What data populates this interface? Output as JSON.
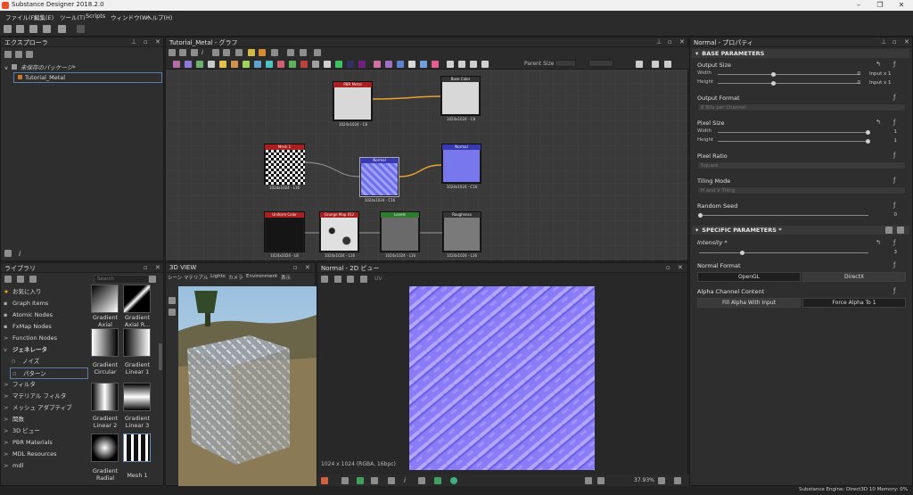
{
  "window": {
    "title": "Substance Designer 2018.2.0"
  },
  "menu": [
    "ファイル(F)",
    "編集(E)",
    "ツール(T)",
    "Scripts",
    "ウィンドウ(W)",
    "ヘルプ(H)"
  ],
  "explorer": {
    "title": "エクスプローラ",
    "package": "未保存のパッケージ*",
    "graph": "Tutorial_Metal"
  },
  "graph": {
    "title": "Tutorial_Metal - グラフ",
    "parent_size_label": "Parent Size",
    "nodes": [
      {
        "name": "PBR Metal Roughness",
        "label": "1024x1024 - C8"
      },
      {
        "name": "Base Color",
        "label": "1024x1024 - C8"
      },
      {
        "name": "Mesh 1",
        "label": "1024x1024 - L16"
      },
      {
        "name": "Normal",
        "label": "1024x1024 - C16"
      },
      {
        "name": "Normal",
        "label": "1024x1024 - C16"
      },
      {
        "name": "Uniform Color",
        "label": "1024x1024 - L8"
      },
      {
        "name": "Grunge Map 012",
        "label": "1024x1024 - L16"
      },
      {
        "name": "Levels",
        "label": "1024x1024 - L16"
      },
      {
        "name": "Roughness",
        "label": "1024x1024 - L16"
      }
    ]
  },
  "library": {
    "title": "ライブラリ",
    "search_placeholder": "Search",
    "items": [
      {
        "arrow": "",
        "label": "お気に入り"
      },
      {
        "arrow": "",
        "label": "Graph Items"
      },
      {
        "arrow": "",
        "label": "Atomic Nodes"
      },
      {
        "arrow": "",
        "label": "FxMap Nodes"
      },
      {
        "arrow": ">",
        "label": "Function Nodes"
      },
      {
        "arrow": "v",
        "label": "ジェネレータ"
      },
      {
        "arrow": "",
        "label": "ノイズ"
      },
      {
        "arrow": "",
        "label": "パターン"
      },
      {
        "arrow": ">",
        "label": "フィルタ"
      },
      {
        "arrow": ">",
        "label": "マテリアル フィルタ"
      },
      {
        "arrow": ">",
        "label": "メッシュ アダプティブ"
      },
      {
        "arrow": ">",
        "label": "関数"
      },
      {
        "arrow": ">",
        "label": "3D ビュー"
      },
      {
        "arrow": ">",
        "label": "PBR Materials"
      },
      {
        "arrow": ">",
        "label": "MDL Resources"
      },
      {
        "arrow": ">",
        "label": "mdl"
      }
    ],
    "thumbs": [
      {
        "label1": "Gradient",
        "label2": "Axial"
      },
      {
        "label1": "Gradient",
        "label2": "Axial R..."
      },
      {
        "label1": "Gradient",
        "label2": "Circular"
      },
      {
        "label1": "Gradient",
        "label2": "Linear 1"
      },
      {
        "label1": "Gradient",
        "label2": "Linear 2"
      },
      {
        "label1": "Gradient",
        "label2": "Linear 3"
      },
      {
        "label1": "Gradient",
        "label2": "Radial"
      },
      {
        "label1": "Mesh 1",
        "label2": ""
      }
    ]
  },
  "view3d": {
    "title": "3D VIEW",
    "menu": [
      "シーン",
      "マテリアル",
      "Lights",
      "カメラ",
      "Environment",
      "表示"
    ]
  },
  "view2d": {
    "title": "Normal - 2D ビュー",
    "footer": "1024 x 1024 (RGBA, 16bpc)",
    "zoom": "37.93%",
    "uv_label": "UV"
  },
  "properties": {
    "title": "Normal - プロパティ",
    "base_section": "BASE PARAMETERS",
    "output_size": "Output Size",
    "width": "Width",
    "height": "Height",
    "output_width_val": "0",
    "output_height_val": "0",
    "input_x1_a": "Input x 1",
    "input_x1_b": "Input x 1",
    "output_format": "Output Format",
    "output_format_val": "8 Bits per Channel",
    "pixel_size": "Pixel Size",
    "pixel_width_val": "1",
    "pixel_height_val": "1",
    "pixel_ratio": "Pixel Ratio",
    "pixel_ratio_val": "Square",
    "tiling_mode": "Tiling Mode",
    "tiling_mode_val": "H and V Tiling",
    "random_seed": "Random Seed",
    "random_seed_val": "0",
    "specific_section": "SPECIFIC PARAMETERS *",
    "intensity": "Intensity *",
    "intensity_val": "3",
    "normal_format": "Normal Format",
    "opengl": "OpenGL",
    "directx": "DirectX",
    "alpha_content": "Alpha Channel Content",
    "fill_alpha": "Fill Alpha With Input",
    "force_alpha": "Force Alpha To 1"
  },
  "status": "Substance Engine: Direct3D 10    Memory: 0%"
}
